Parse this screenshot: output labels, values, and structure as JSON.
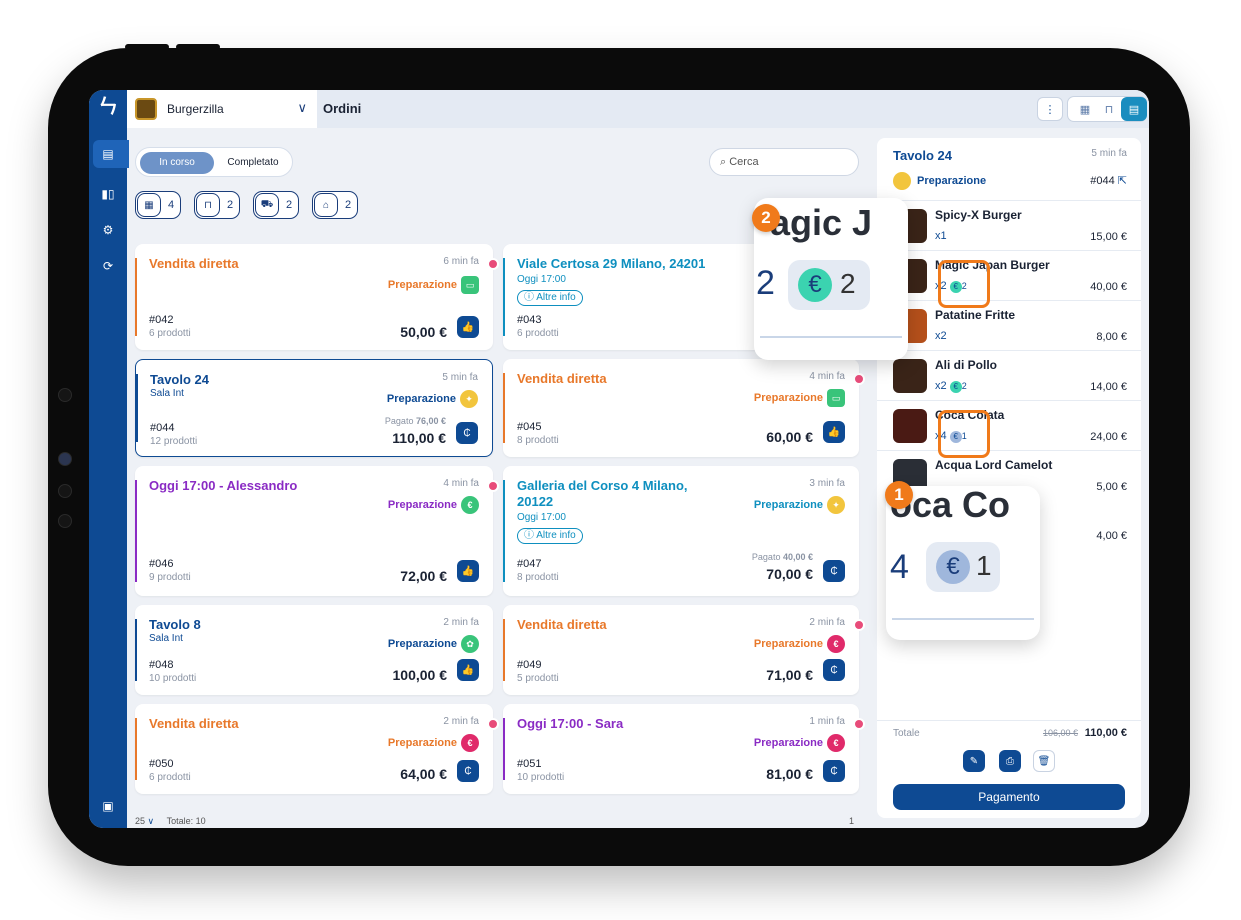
{
  "venue": {
    "name": "Burgerzilla"
  },
  "page": {
    "title": "Ordini"
  },
  "filters": {
    "active": "In corso",
    "other": "Completato",
    "search_placeholder": "Cerca"
  },
  "chips": [
    {
      "icon": "cash-register-icon",
      "count": "4"
    },
    {
      "icon": "table-icon",
      "count": "2"
    },
    {
      "icon": "delivery-icon",
      "count": "2"
    },
    {
      "icon": "takeaway-icon",
      "count": "2"
    }
  ],
  "orders": [
    {
      "title": "Vendita diretta",
      "sub": "",
      "time": "6 min fa",
      "state": "Preparazione",
      "num": "#042",
      "products": "6 prodotti",
      "amount": "50,00 €",
      "paid": "",
      "color": "#e8782a"
    },
    {
      "title": "Viale Certosa 29 Milano, 24201",
      "sub": "Oggi 17:00",
      "info": "Altre info",
      "time": "",
      "state": "P",
      "num": "#043",
      "products": "6 prodotti",
      "amount": "",
      "paid": "",
      "color": "#0e8fbf"
    },
    {
      "title": "Tavolo 24",
      "sub": "Sala Int",
      "time": "5 min fa",
      "state": "Preparazione",
      "num": "#044",
      "products": "12 prodotti",
      "amount": "110,00 €",
      "paid_label": "Pagato",
      "paid": "76,00 €",
      "color": "#0e4a93"
    },
    {
      "title": "Vendita diretta",
      "sub": "",
      "time": "4 min fa",
      "state": "Preparazione",
      "num": "#045",
      "products": "8 prodotti",
      "amount": "60,00 €",
      "paid": "",
      "color": "#e8782a"
    },
    {
      "title": "Oggi 17:00 - Alessandro",
      "sub": "",
      "time": "4 min fa",
      "state": "Preparazione",
      "num": "#046",
      "products": "9 prodotti",
      "amount": "72,00 €",
      "paid": "",
      "color": "#8a2bc4"
    },
    {
      "title": "Galleria del Corso 4 Milano,",
      "title2": "20122",
      "sub": "Oggi 17:00",
      "info": "Altre info",
      "time": "3 min fa",
      "state": "Preparazione",
      "num": "#047",
      "products": "8 prodotti",
      "amount": "70,00 €",
      "paid_label": "Pagato",
      "paid": "40,00 €",
      "color": "#0e8fbf"
    },
    {
      "title": "Tavolo 8",
      "sub": "Sala Int",
      "time": "2 min fa",
      "state": "Preparazione",
      "num": "#048",
      "products": "10 prodotti",
      "amount": "100,00 €",
      "paid": "",
      "color": "#0e4a93"
    },
    {
      "title": "Vendita diretta",
      "sub": "",
      "time": "2 min fa",
      "state": "Preparazione",
      "num": "#049",
      "products": "5 prodotti",
      "amount": "71,00 €",
      "paid": "",
      "color": "#e8782a"
    },
    {
      "title": "Vendita diretta",
      "sub": "",
      "time": "2 min fa",
      "state": "Preparazione",
      "num": "#050",
      "products": "6 prodotti",
      "amount": "64,00 €",
      "paid": "",
      "color": "#e8782a"
    },
    {
      "title": "Oggi 17:00 - Sara",
      "sub": "",
      "time": "1 min fa",
      "state": "Preparazione",
      "num": "#051",
      "products": "10 prodotti",
      "amount": "81,00 €",
      "paid": "",
      "color": "#8a2bc4"
    }
  ],
  "pager": {
    "size": "25",
    "total": "Totale: 10",
    "page": "1"
  },
  "detail": {
    "title": "Tavolo 24",
    "time": "5 min fa",
    "state": "Preparazione",
    "num": "#044",
    "lines": [
      {
        "name": "Spicy-X Burger",
        "qty": "x1",
        "paid": "",
        "price": "15,00 €"
      },
      {
        "name": "Magic Japan Burger",
        "qty": "x2",
        "paid": "2",
        "price": "40,00 €"
      },
      {
        "name": "Patatine Fritte",
        "qty": "x2",
        "paid": "",
        "price": "8,00 €"
      },
      {
        "name": "Ali di Pollo",
        "qty": "x2",
        "paid": "2",
        "price": "14,00 €"
      },
      {
        "name": "Coca Colata",
        "qty": "x4",
        "paid": "1",
        "price": "24,00 €"
      },
      {
        "name": "Acqua Lord Camelot",
        "qty": "x1",
        "paid": "",
        "price": "5,00 €"
      }
    ],
    "extra_price": "4,00 €",
    "total_label": "Totale",
    "total_old": "106,00 €",
    "total_new": "110,00 €",
    "pay_label": "Pagamento"
  },
  "callouts": {
    "one": {
      "badge": "1",
      "text": "oca Co",
      "qty": "4",
      "paid": "1"
    },
    "two": {
      "badge": "2",
      "text": "agic J",
      "qty": "2",
      "paid": "2"
    }
  }
}
